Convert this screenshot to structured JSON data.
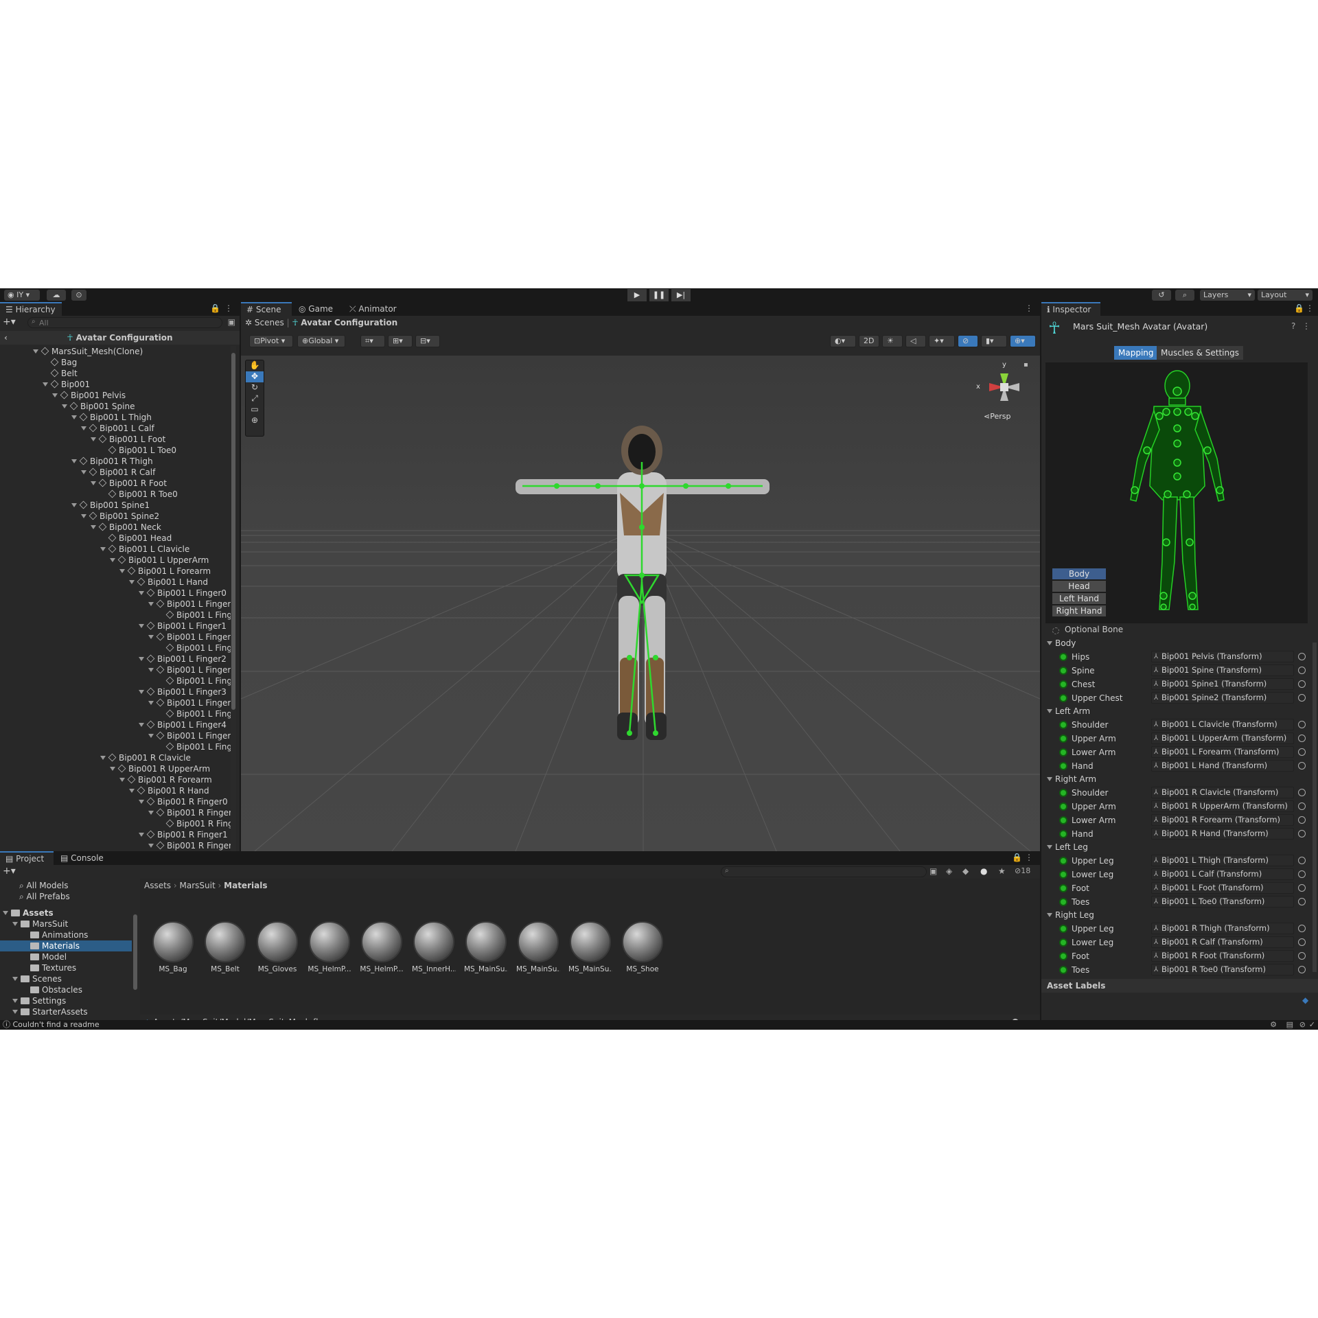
{
  "toolbar": {
    "account": "IY",
    "layers": "Layers",
    "layout": "Layout"
  },
  "hierarchy": {
    "tab": "Hierarchy",
    "search_placeholder": "All",
    "header": "Avatar Configuration",
    "rows": [
      {
        "label": "MarsSuit_Mesh(Clone)",
        "depth": 0,
        "exp": true
      },
      {
        "label": "Bag",
        "depth": 1
      },
      {
        "label": "Belt",
        "depth": 1
      },
      {
        "label": "Bip001",
        "depth": 1,
        "exp": true
      },
      {
        "label": "Bip001 Pelvis",
        "depth": 2,
        "exp": true
      },
      {
        "label": "Bip001 Spine",
        "depth": 3,
        "exp": true
      },
      {
        "label": "Bip001 L Thigh",
        "depth": 4,
        "exp": true
      },
      {
        "label": "Bip001 L Calf",
        "depth": 5,
        "exp": true
      },
      {
        "label": "Bip001 L Foot",
        "depth": 6,
        "exp": true
      },
      {
        "label": "Bip001 L Toe0",
        "depth": 7
      },
      {
        "label": "Bip001 R Thigh",
        "depth": 4,
        "exp": true
      },
      {
        "label": "Bip001 R Calf",
        "depth": 5,
        "exp": true
      },
      {
        "label": "Bip001 R Foot",
        "depth": 6,
        "exp": true
      },
      {
        "label": "Bip001 R Toe0",
        "depth": 7
      },
      {
        "label": "Bip001 Spine1",
        "depth": 4,
        "exp": true
      },
      {
        "label": "Bip001 Spine2",
        "depth": 5,
        "exp": true
      },
      {
        "label": "Bip001 Neck",
        "depth": 6,
        "exp": true
      },
      {
        "label": "Bip001 Head",
        "depth": 7
      },
      {
        "label": "Bip001 L Clavicle",
        "depth": 7,
        "exp": true
      },
      {
        "label": "Bip001 L UpperArm",
        "depth": 8,
        "exp": true
      },
      {
        "label": "Bip001 L Forearm",
        "depth": 9,
        "exp": true
      },
      {
        "label": "Bip001 L Hand",
        "depth": 10,
        "exp": true
      },
      {
        "label": "Bip001 L Finger0",
        "depth": 11,
        "exp": true
      },
      {
        "label": "Bip001 L Finger",
        "depth": 12,
        "exp": true
      },
      {
        "label": "Bip001 L Fing",
        "depth": 13
      },
      {
        "label": "Bip001 L Finger1",
        "depth": 11,
        "exp": true
      },
      {
        "label": "Bip001 L Finger",
        "depth": 12,
        "exp": true
      },
      {
        "label": "Bip001 L Fing",
        "depth": 13
      },
      {
        "label": "Bip001 L Finger2",
        "depth": 11,
        "exp": true
      },
      {
        "label": "Bip001 L Finger",
        "depth": 12,
        "exp": true
      },
      {
        "label": "Bip001 L Fing",
        "depth": 13
      },
      {
        "label": "Bip001 L Finger3",
        "depth": 11,
        "exp": true
      },
      {
        "label": "Bip001 L Finger",
        "depth": 12,
        "exp": true
      },
      {
        "label": "Bip001 L Fing",
        "depth": 13
      },
      {
        "label": "Bip001 L Finger4",
        "depth": 11,
        "exp": true
      },
      {
        "label": "Bip001 L Finger",
        "depth": 12,
        "exp": true
      },
      {
        "label": "Bip001 L Fing",
        "depth": 13
      },
      {
        "label": "Bip001 R Clavicle",
        "depth": 7,
        "exp": true
      },
      {
        "label": "Bip001 R UpperArm",
        "depth": 8,
        "exp": true
      },
      {
        "label": "Bip001 R Forearm",
        "depth": 9,
        "exp": true
      },
      {
        "label": "Bip001 R Hand",
        "depth": 10,
        "exp": true
      },
      {
        "label": "Bip001 R Finger0",
        "depth": 11,
        "exp": true
      },
      {
        "label": "Bip001 R Finger",
        "depth": 12,
        "exp": true
      },
      {
        "label": "Bip001 R Fing",
        "depth": 13
      },
      {
        "label": "Bip001 R Finger1",
        "depth": 11,
        "exp": true
      },
      {
        "label": "Bip001 R Finger",
        "depth": 12,
        "exp": true
      }
    ]
  },
  "scene": {
    "tabs": [
      "Scene",
      "Game",
      "Animator"
    ],
    "breadcrumb_root": "Scenes",
    "breadcrumb_current": "Avatar Configuration",
    "pivot": "Pivot",
    "global": "Global",
    "mode_2d": "2D",
    "persp": "Persp",
    "gizmo_y": "y",
    "gizmo_x": "x"
  },
  "inspector": {
    "tab": "Inspector",
    "title": "Mars Suit_Mesh Avatar (Avatar)",
    "mapping": "Mapping",
    "muscles": "Muscles & Settings",
    "parts": [
      "Body",
      "Head",
      "Left Hand",
      "Right Hand"
    ],
    "optional_bone": "Optional Bone",
    "groups": [
      {
        "name": "Body",
        "bones": [
          [
            "Hips",
            "Bip001 Pelvis (Transform)"
          ],
          [
            "Spine",
            "Bip001 Spine (Transform)"
          ],
          [
            "Chest",
            "Bip001 Spine1 (Transform)"
          ],
          [
            "Upper Chest",
            "Bip001 Spine2 (Transform)"
          ]
        ]
      },
      {
        "name": "Left Arm",
        "bones": [
          [
            "Shoulder",
            "Bip001 L Clavicle (Transform)"
          ],
          [
            "Upper Arm",
            "Bip001 L UpperArm (Transform)"
          ],
          [
            "Lower Arm",
            "Bip001 L Forearm (Transform)"
          ],
          [
            "Hand",
            "Bip001 L Hand (Transform)"
          ]
        ]
      },
      {
        "name": "Right Arm",
        "bones": [
          [
            "Shoulder",
            "Bip001 R Clavicle (Transform)"
          ],
          [
            "Upper Arm",
            "Bip001 R UpperArm (Transform)"
          ],
          [
            "Lower Arm",
            "Bip001 R Forearm (Transform)"
          ],
          [
            "Hand",
            "Bip001 R Hand (Transform)"
          ]
        ]
      },
      {
        "name": "Left Leg",
        "bones": [
          [
            "Upper Leg",
            "Bip001 L Thigh (Transform)"
          ],
          [
            "Lower Leg",
            "Bip001 L Calf (Transform)"
          ],
          [
            "Foot",
            "Bip001 L Foot (Transform)"
          ],
          [
            "Toes",
            "Bip001 L Toe0 (Transform)"
          ]
        ]
      },
      {
        "name": "Right Leg",
        "bones": [
          [
            "Upper Leg",
            "Bip001 R Thigh (Transform)"
          ],
          [
            "Lower Leg",
            "Bip001 R Calf (Transform)"
          ],
          [
            "Foot",
            "Bip001 R Foot (Transform)"
          ],
          [
            "Toes",
            "Bip001 R Toe0 (Transform)"
          ]
        ]
      }
    ],
    "asset_labels": "Asset Labels"
  },
  "project": {
    "tabs": [
      "Project",
      "Console"
    ],
    "hidden_count": "18",
    "favorites": [
      "All Models",
      "All Prefabs"
    ],
    "tree": [
      {
        "label": "Assets",
        "depth": 0,
        "bold": true
      },
      {
        "label": "MarsSuit",
        "depth": 1
      },
      {
        "label": "Animations",
        "depth": 2
      },
      {
        "label": "Materials",
        "depth": 2,
        "sel": true
      },
      {
        "label": "Model",
        "depth": 2
      },
      {
        "label": "Textures",
        "depth": 2
      },
      {
        "label": "Scenes",
        "depth": 1
      },
      {
        "label": "Obstacles",
        "depth": 2
      },
      {
        "label": "Settings",
        "depth": 1
      },
      {
        "label": "StarterAssets",
        "depth": 1
      }
    ],
    "breadcrumb": [
      "Assets",
      "MarsSuit",
      "Materials"
    ],
    "assets": [
      "MS_Bag",
      "MS_Belt",
      "MS_Gloves",
      "MS_HelmP...",
      "MS_HelmP...",
      "MS_InnerH...",
      "MS_MainSu...",
      "MS_MainSu...",
      "MS_MainSu...",
      "MS_Shoe"
    ],
    "path": "Assets/MarsSuit/Model/MarsSuit_Mesh.fbx"
  },
  "status": {
    "message": "Couldn't find a readme"
  },
  "colors": {
    "accent": "#3a79bb",
    "bone_green": "#25b525"
  }
}
